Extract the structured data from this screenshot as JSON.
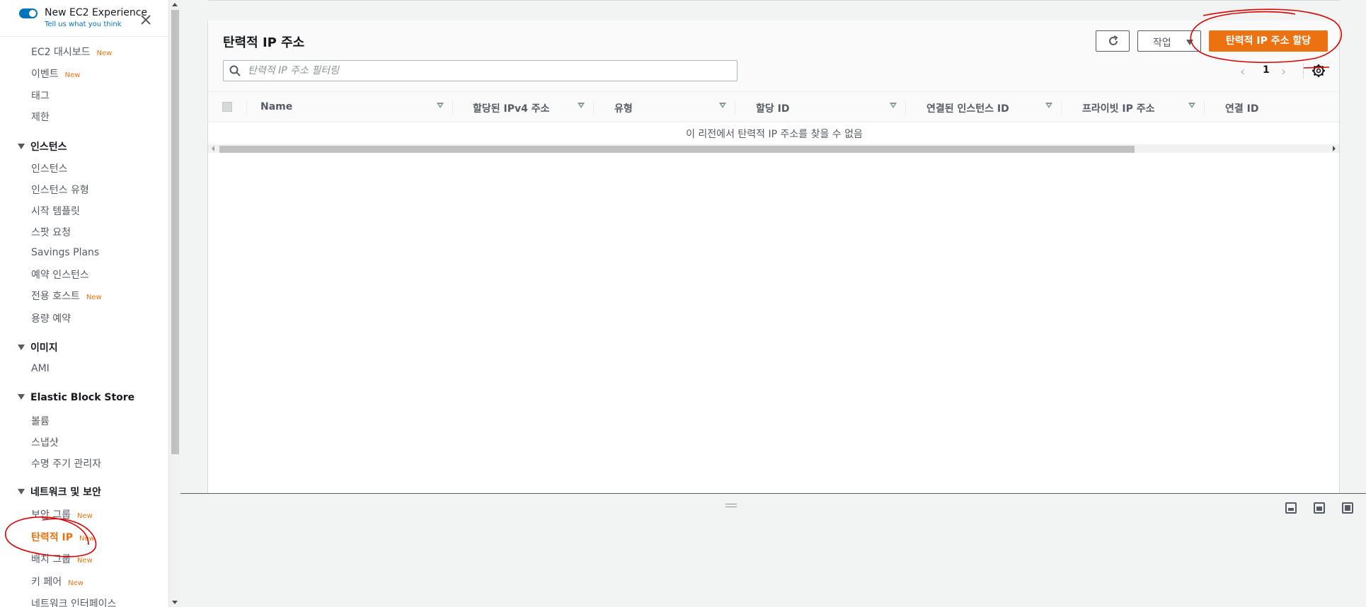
{
  "sidebar": {
    "toggle_title": "New EC2 Experience",
    "toggle_subtitle": "Tell us what you think",
    "new_badge": "New",
    "items": {
      "dashboard": "EC2 대시보드",
      "events": "이벤트",
      "tags": "태그",
      "limits": "제한",
      "instances": "인스턴스",
      "instance_types": "인스턴스 유형",
      "launch_templates": "시작 템플릿",
      "spot_requests": "스팟 요청",
      "savings_plans": "Savings Plans",
      "reserved_instances": "예약 인스턴스",
      "dedicated_hosts": "전용 호스트",
      "capacity_reservations": "용량 예약",
      "ami": "AMI",
      "volumes": "볼륨",
      "snapshots": "스냅샷",
      "lifecycle_manager": "수명 주기 관리자",
      "security_groups": "보안 그룹",
      "elastic_ips": "탄력적 IP",
      "placement_groups": "배치 그룹",
      "key_pairs": "키 페어",
      "network_interfaces": "네트워크 인터페이스"
    },
    "sections": {
      "instances": "인스턴스",
      "images": "이미지",
      "ebs": "Elastic Block Store",
      "network_security": "네트워크 및 보안"
    }
  },
  "main": {
    "title": "탄력적 IP 주소",
    "search_placeholder": "탄력적 IP 주소 필터링",
    "actions_label": "작업",
    "allocate_label": "탄력적 IP 주소 할당",
    "page_number": "1",
    "columns": [
      "Name",
      "할당된 IPv4 주소",
      "유형",
      "할당 ID",
      "연결된 인스턴스 ID",
      "프라이빗 IP 주소",
      "연결 ID"
    ],
    "empty_message": "이 리전에서 탄력적 IP 주소를 찾을 수 없음"
  },
  "colors": {
    "accent": "#ec7211",
    "link": "#0073bb",
    "annotation": "#e00000"
  }
}
